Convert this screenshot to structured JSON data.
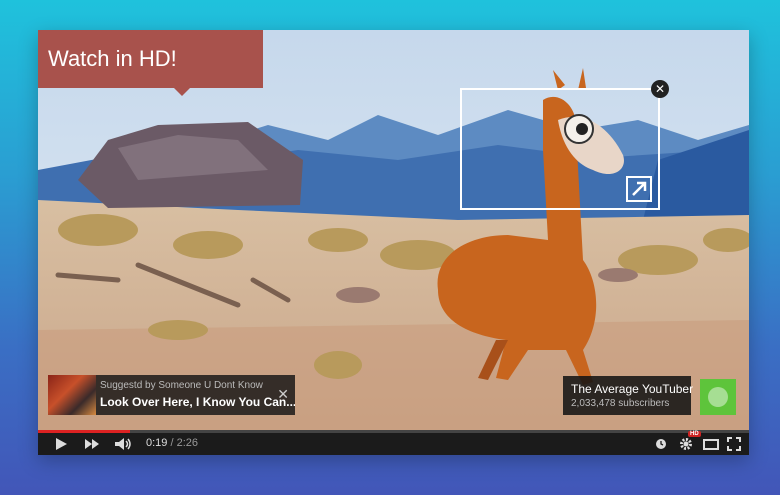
{
  "banner": {
    "text": "Watch in HD!"
  },
  "annotation": {
    "close_glyph": "✕",
    "link_icon": "external-link-icon"
  },
  "suggestion": {
    "byline": "Suggestd by Someone U Dont Know",
    "title": "Look Over Here, I Know You Can...",
    "close_glyph": "✕"
  },
  "channel": {
    "name": "The Average YouTuber",
    "subscribers": "2,033,478 subscribers"
  },
  "player": {
    "current_time": "0:19",
    "separator": " / ",
    "duration": "2:26",
    "progress_fraction": 0.13,
    "hd_badge": "HD"
  },
  "colors": {
    "banner": "#a8524c",
    "subscribe": "#5ec43b",
    "progress": "#dd2222"
  }
}
